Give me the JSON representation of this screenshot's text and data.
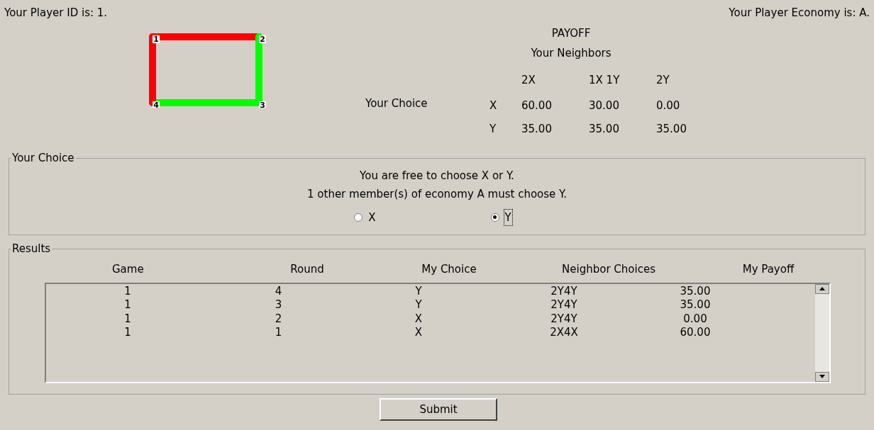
{
  "header": {
    "player_id": "Your Player ID is:  1.",
    "economy": "Your Player Economy is: A."
  },
  "network": {
    "nodes": [
      "1",
      "2",
      "4",
      "3"
    ],
    "edges": [
      {
        "color": "#ff0000"
      },
      {
        "color": "#00ff00"
      },
      {
        "color": "#00ff00"
      },
      {
        "color": "#ff0000"
      }
    ]
  },
  "payoff": {
    "title": "PAYOFF",
    "subtitle": "Your Neighbors",
    "row_heading": "Your Choice",
    "columns": [
      "2X",
      "1X 1Y",
      "2Y"
    ],
    "rows": [
      {
        "label": "X",
        "values": [
          "60.00",
          "30.00",
          "0.00"
        ]
      },
      {
        "label": "Y",
        "values": [
          "35.00",
          "35.00",
          "35.00"
        ]
      }
    ]
  },
  "choice": {
    "legend": "Your Choice",
    "lines": [
      "You are free to choose X or Y.",
      "1 other member(s) of economy A must choose Y."
    ],
    "options": [
      {
        "label": "X",
        "selected": false
      },
      {
        "label": "Y",
        "selected": true
      }
    ]
  },
  "results": {
    "legend": "Results",
    "columns": [
      "Game",
      "Round",
      "My Choice",
      "Neighbor Choices",
      "My Payoff"
    ],
    "rows": [
      [
        "1",
        "4",
        "Y",
        "2Y4Y",
        "35.00"
      ],
      [
        "1",
        "3",
        "Y",
        "2Y4Y",
        "35.00"
      ],
      [
        "1",
        "2",
        "X",
        "2Y4Y",
        "0.00"
      ],
      [
        "1",
        "1",
        "X",
        "2X4X",
        "60.00"
      ]
    ]
  },
  "submit": "Submit"
}
